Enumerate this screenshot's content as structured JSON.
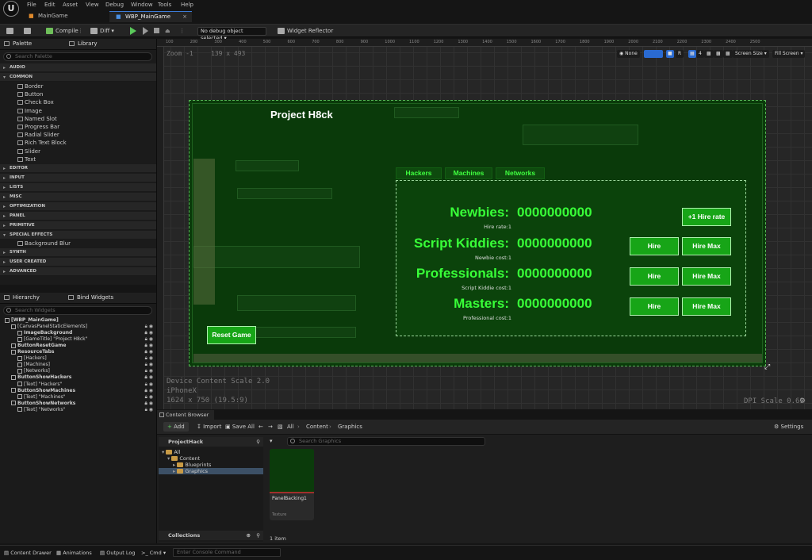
{
  "menu": [
    "File",
    "Edit",
    "Asset",
    "View",
    "Debug",
    "Window",
    "Tools",
    "Help"
  ],
  "tabs": [
    {
      "label": "MainGame",
      "active": false
    },
    {
      "label": "WBP_MainGame",
      "active": true
    }
  ],
  "toolbar": {
    "compile": "Compile",
    "diff": "Diff",
    "debug_object": "No debug object selected",
    "widget_reflector": "Widget Reflector"
  },
  "palette": {
    "tab_palette": "Palette",
    "tab_library": "Library",
    "search_placeholder": "Search Palette",
    "categories_top": [
      "AUDIO",
      "COMMON"
    ],
    "common_items": [
      "Border",
      "Button",
      "Check Box",
      "Image",
      "Named Slot",
      "Progress Bar",
      "Radial Slider",
      "Rich Text Block",
      "Slider",
      "Text"
    ],
    "categories_mid": [
      "EDITOR",
      "INPUT",
      "LISTS",
      "MISC",
      "OPTIMIZATION",
      "PANEL",
      "PRIMITIVE",
      "SPECIAL EFFECTS"
    ],
    "special_items": [
      "Background Blur"
    ],
    "categories_bottom": [
      "SYNTH",
      "USER CREATED",
      "ADVANCED"
    ]
  },
  "hierarchy": {
    "tab_hierarchy": "Hierarchy",
    "tab_bind": "Bind Widgets",
    "search_placeholder": "Search Widgets",
    "rows": [
      {
        "text": "[WBP_MainGame]",
        "indent": 0,
        "bold": true
      },
      {
        "text": "[CanvasPanelStaticElements]",
        "indent": 1
      },
      {
        "text": "ImageBackground",
        "indent": 2,
        "bold": true
      },
      {
        "text": "[GameTitle] \"Project H8ck\"",
        "indent": 2
      },
      {
        "text": "ButtonResetGame",
        "indent": 1,
        "bold": true
      },
      {
        "text": "ResourceTabs",
        "indent": 1,
        "bold": true
      },
      {
        "text": "[Hackers]",
        "indent": 2
      },
      {
        "text": "[Machines]",
        "indent": 2
      },
      {
        "text": "[Networks]",
        "indent": 2
      },
      {
        "text": "ButtonShowHackers",
        "indent": 1,
        "bold": true
      },
      {
        "text": "[Text] \"Hackers\"",
        "indent": 2
      },
      {
        "text": "ButtonShowMachines",
        "indent": 1,
        "bold": true
      },
      {
        "text": "[Text] \"Machines\"",
        "indent": 2
      },
      {
        "text": "ButtonShowNetworks",
        "indent": 1,
        "bold": true
      },
      {
        "text": "[Text] \"Networks\"",
        "indent": 2
      }
    ]
  },
  "viewport": {
    "zoom": "Zoom -1",
    "size": "139 x 493",
    "ruler_ticks": [
      "100",
      "200",
      "300",
      "400",
      "500",
      "600",
      "700",
      "800",
      "900",
      "1000",
      "1100",
      "1200",
      "1300",
      "1400",
      "1500",
      "1600",
      "1700",
      "1800",
      "1900",
      "2000",
      "2100",
      "2200",
      "2300",
      "2400",
      "2500"
    ],
    "none_label": "None",
    "r_label": "R",
    "grid_value": "4",
    "screen_size": "Screen Size",
    "fill_screen": "Fill Screen",
    "device_scale": "Device Content Scale 2.0",
    "device": "iPhoneX",
    "resolution": "1624 x 750 (19.5:9)",
    "dpi": "DPI Scale 0.69"
  },
  "game": {
    "title": "Project H8ck",
    "tabs": [
      "Hackers",
      "Machines",
      "Networks"
    ],
    "reset": "Reset Game",
    "resources": [
      {
        "name": "Newbies:",
        "value": "0000000000",
        "sub": "Hire rate:1",
        "buttons": [
          "+1 Hire rate"
        ]
      },
      {
        "name": "Script Kiddies:",
        "value": "0000000000",
        "sub": "Newbie cost:1",
        "buttons": [
          "Hire",
          "Hire Max"
        ]
      },
      {
        "name": "Professionals:",
        "value": "0000000000",
        "sub": "Script Kiddie cost:1",
        "buttons": [
          "Hire",
          "Hire Max"
        ]
      },
      {
        "name": "Masters:",
        "value": "0000000000",
        "sub": "Professional cost:1",
        "buttons": [
          "Hire",
          "Hire Max"
        ]
      }
    ]
  },
  "content_browser": {
    "tab": "Content Browser 2",
    "add": "Add",
    "import": "Import",
    "save_all": "Save All",
    "breadcrumb": [
      "All",
      "Content",
      "Graphics"
    ],
    "settings": "Settings",
    "project": "ProjectHack",
    "search_placeholder": "Search Graphics",
    "tree": [
      {
        "text": "All",
        "indent": 0
      },
      {
        "text": "Content",
        "indent": 1
      },
      {
        "text": "Blueprints",
        "indent": 2
      },
      {
        "text": "Graphics",
        "indent": 2,
        "selected": true
      }
    ],
    "collections": "Collections",
    "asset_name": "PanelBacking1",
    "asset_type": "Texture",
    "count": "1 item"
  },
  "statusbar": {
    "content_drawer": "Content Drawer",
    "animations": "Animations",
    "output_log": "Output Log",
    "cmd": "Cmd",
    "console_placeholder": "Enter Console Command"
  }
}
